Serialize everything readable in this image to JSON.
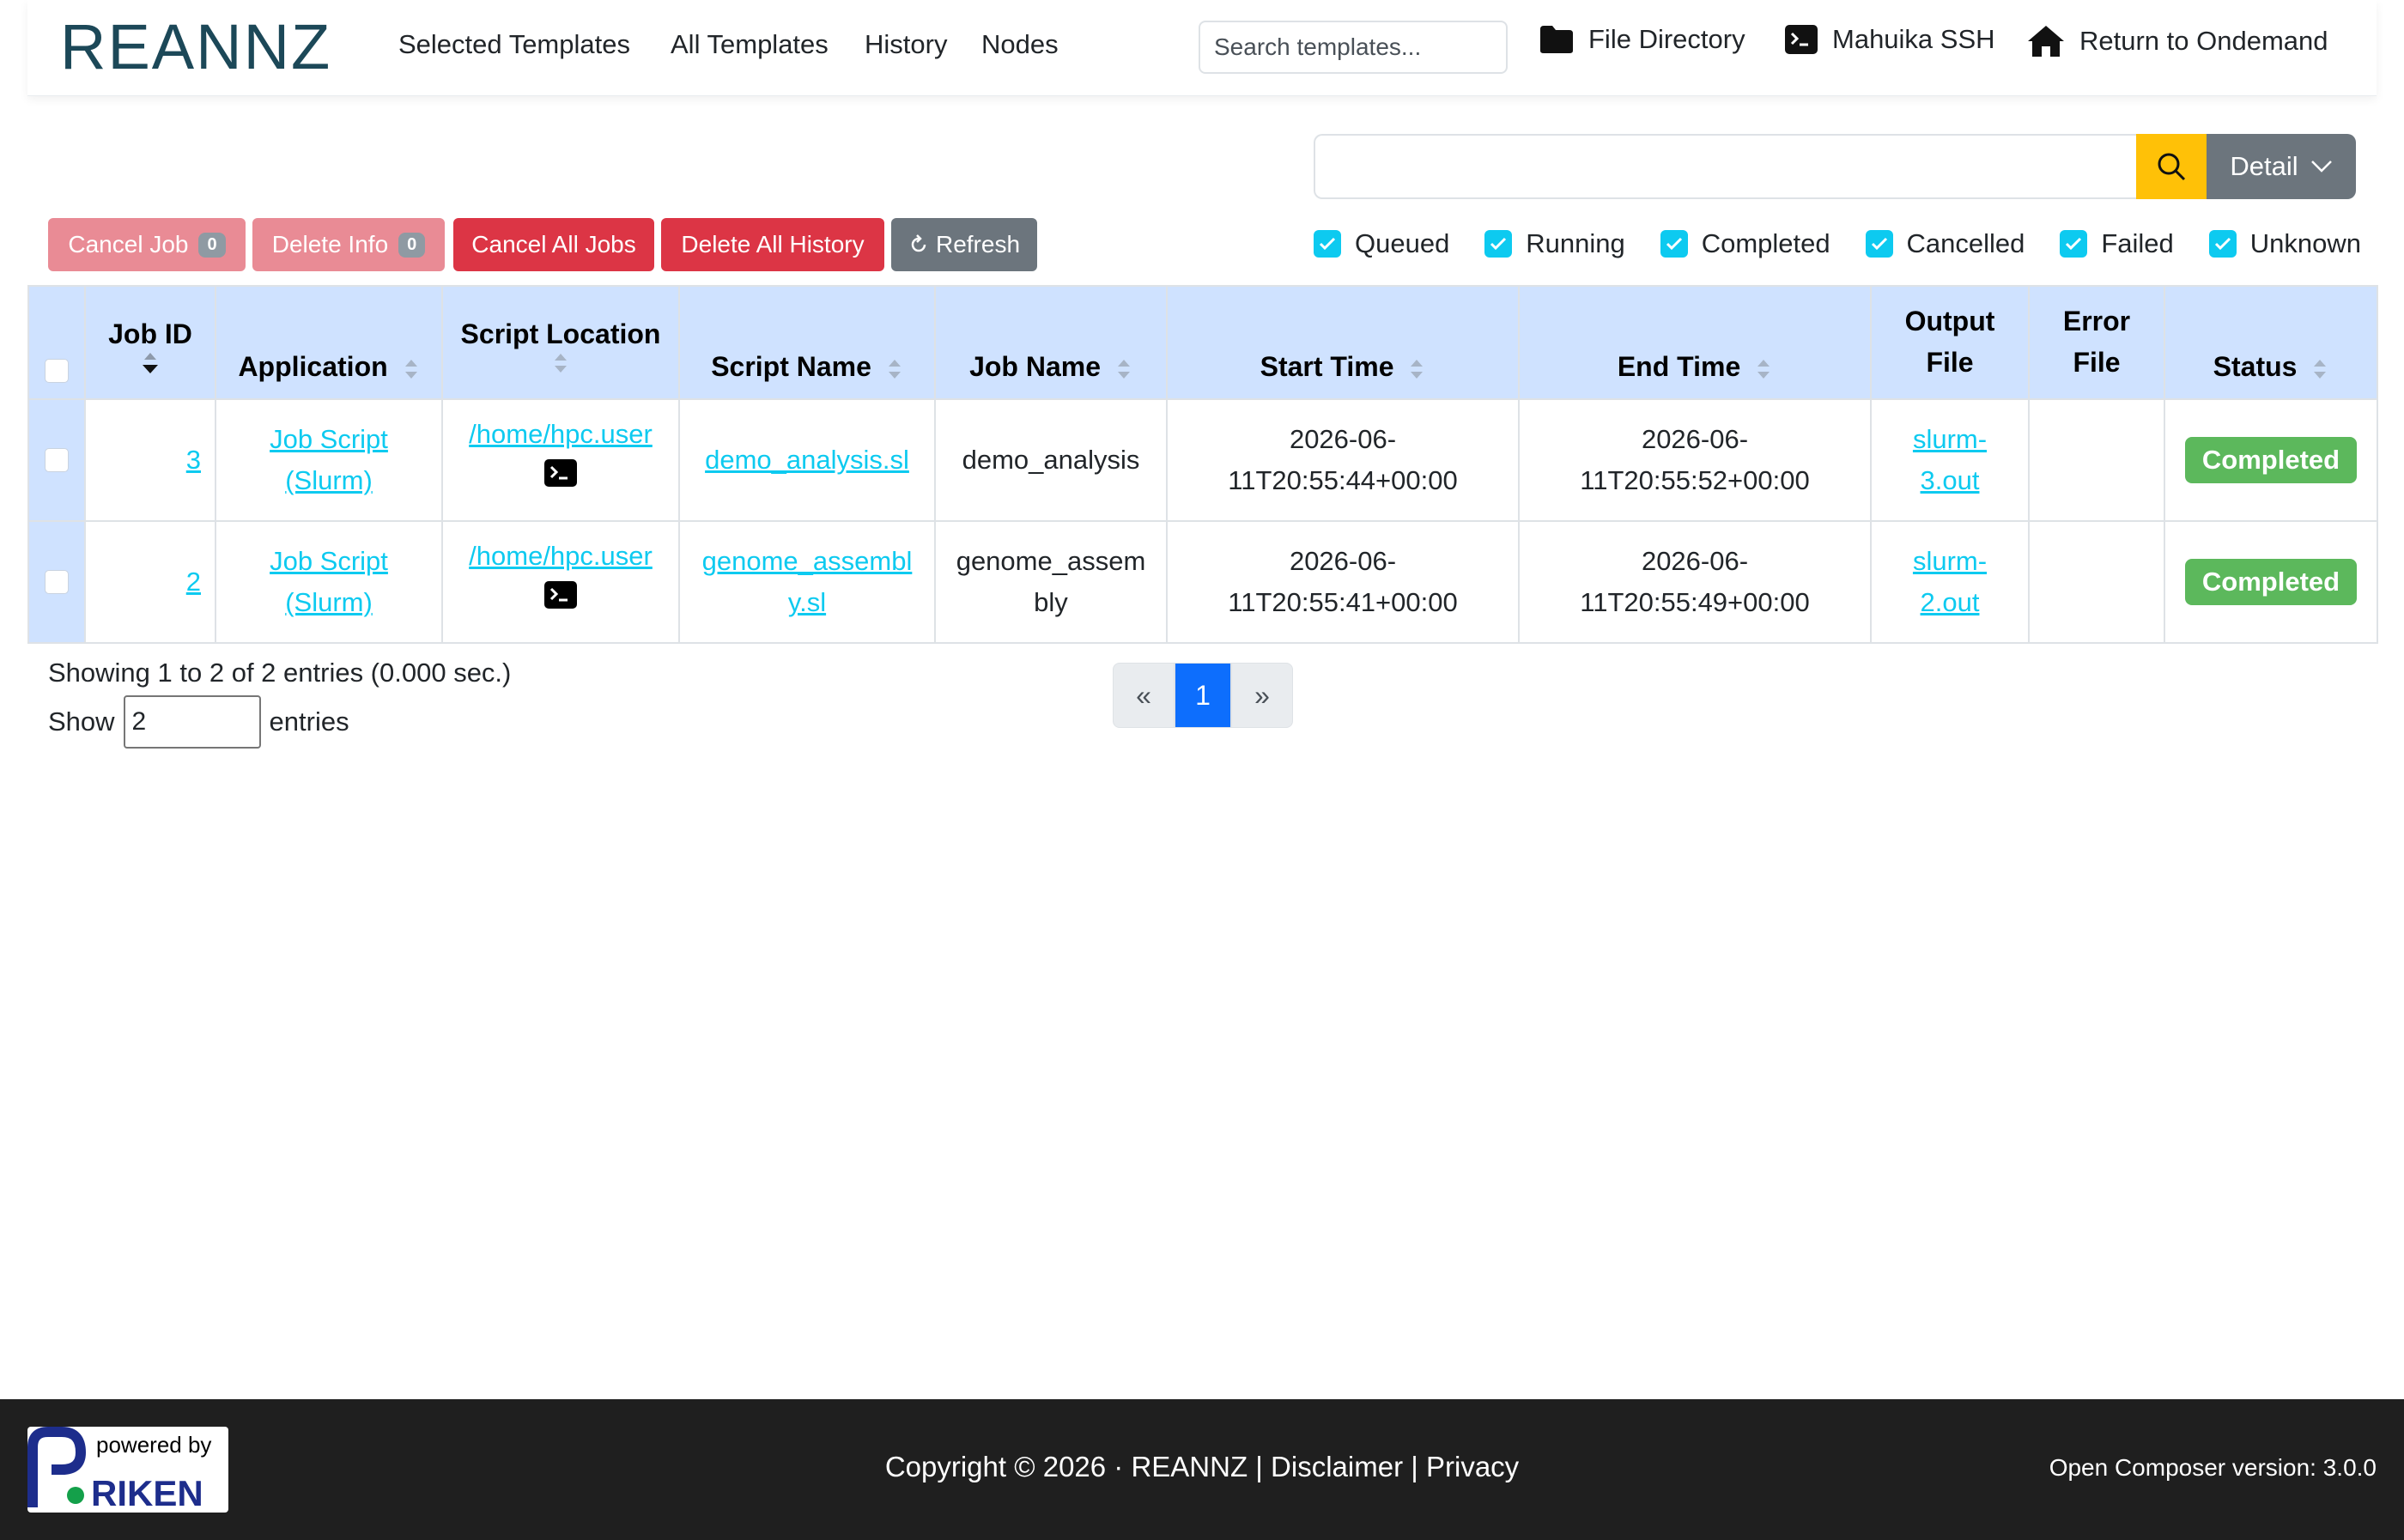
{
  "nav": {
    "logo_text": "REANNZ",
    "links": [
      "Selected Templates",
      "All Templates",
      "History",
      "Nodes"
    ],
    "search_placeholder": "Search templates...",
    "file_directory": "File Directory",
    "ssh": "Mahuika SSH",
    "return": "Return to Ondemand"
  },
  "toolbar": {
    "detail_label": "Detail",
    "cancel_job": "Cancel Job",
    "cancel_job_count": "0",
    "delete_info": "Delete Info",
    "delete_info_count": "0",
    "cancel_all": "Cancel All Jobs",
    "delete_all": "Delete All History",
    "refresh": "Refresh",
    "accent_color": "#ffc107"
  },
  "status_filters": [
    {
      "label": "Queued",
      "checked": true
    },
    {
      "label": "Running",
      "checked": true
    },
    {
      "label": "Completed",
      "checked": true
    },
    {
      "label": "Cancelled",
      "checked": true
    },
    {
      "label": "Failed",
      "checked": true
    },
    {
      "label": "Unknown",
      "checked": true
    }
  ],
  "table": {
    "headers": {
      "job_id": "Job ID",
      "application": "Application",
      "script_location": "Script Location",
      "script_name": "Script Name",
      "job_name": "Job Name",
      "start_time": "Start Time",
      "end_time": "End Time",
      "output_file_1": "Output",
      "output_file_2": "File",
      "error_file_1": "Error",
      "error_file_2": "File",
      "status": "Status"
    },
    "rows": [
      {
        "job_id": "3",
        "application_1": "Job Script",
        "application_2": "(Slurm)",
        "script_location": "/home/hpc.user",
        "script_name": "demo_analysis.sl",
        "job_name": "demo_analysis",
        "start_1": "2026-06-",
        "start_2": "11T20:55:44+00:00",
        "end_1": "2026-06-",
        "end_2": "11T20:55:52+00:00",
        "output_1": "slurm-",
        "output_2": "3.out",
        "error_file": "",
        "status": "Completed"
      },
      {
        "job_id": "2",
        "application_1": "Job Script",
        "application_2": "(Slurm)",
        "script_location": "/home/hpc.user",
        "script_name_1": "genome_assembl",
        "script_name_2": "y.sl",
        "job_name_1": "genome_assem",
        "job_name_2": "bly",
        "start_1": "2026-06-",
        "start_2": "11T20:55:41+00:00",
        "end_1": "2026-06-",
        "end_2": "11T20:55:49+00:00",
        "output_1": "slurm-",
        "output_2": "2.out",
        "error_file": "",
        "status": "Completed"
      }
    ]
  },
  "pagination": {
    "info": "Showing 1 to 2 of 2 entries (0.000 sec.)",
    "show_label": "Show",
    "show_value": "2",
    "entries_label": "entries",
    "prev": "«",
    "current": "1",
    "next": "»"
  },
  "footer": {
    "powered_by": "powered by",
    "riken": "RIKEN",
    "copyright": "Copyright © 2026 · REANNZ",
    "sep": "|",
    "disclaimer": "Disclaimer",
    "privacy": "Privacy",
    "version": "Open Composer version: 3.0.0"
  }
}
